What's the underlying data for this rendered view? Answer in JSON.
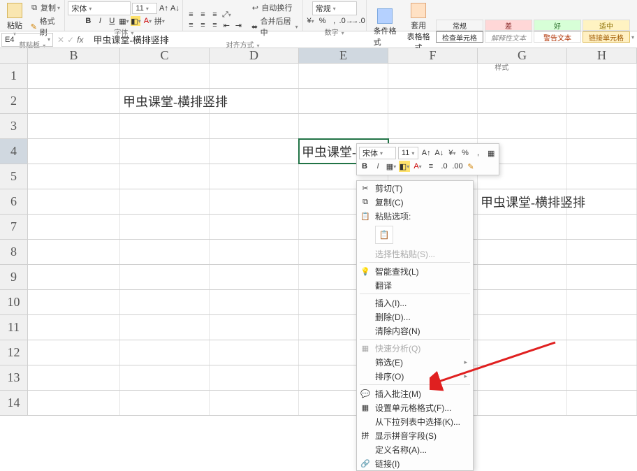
{
  "ribbon": {
    "paste": {
      "label": "粘贴",
      "copy": "复制",
      "fmt_painter": "格式刷"
    },
    "clipboard_label": "剪贴板",
    "font": {
      "name": "宋体",
      "size": "11",
      "label": "字体"
    },
    "align": {
      "wrap": "自动换行",
      "merge": "合并后居中",
      "label": "对齐方式"
    },
    "number": {
      "general": "常规",
      "label": "数字"
    },
    "cond_fmt": "条件格式",
    "as_table": "套用\n表格格式",
    "check_cell": "检查单元格",
    "styles": {
      "normal": "常规",
      "bad": "差",
      "good": "好",
      "neutral": "适中",
      "explain": "解释性文本",
      "warn": "警告文本",
      "link": "链接单元格"
    },
    "styles_label": "样式"
  },
  "formula_bar": {
    "name_box": "E4",
    "value": "甲虫课堂-横排竖排"
  },
  "columns": [
    "B",
    "C",
    "D",
    "E",
    "F",
    "G",
    "H"
  ],
  "rows": [
    "1",
    "2",
    "3",
    "4",
    "5",
    "6",
    "7",
    "8",
    "9",
    "10",
    "11",
    "12",
    "13",
    "14"
  ],
  "cells": {
    "C2": "甲虫课堂-横排竖排",
    "E4": "甲虫课堂-横排竖排",
    "G6": "甲虫课堂-横排竖排"
  },
  "mini_toolbar": {
    "font": "宋体",
    "size": "11"
  },
  "context_menu": {
    "cut": "剪切(T)",
    "copy": "复制(C)",
    "paste_opts": "粘贴选项:",
    "paste_special": "选择性粘贴(S)...",
    "smart_lookup": "智能查找(L)",
    "translate": "翻译",
    "insert": "插入(I)...",
    "delete": "删除(D)...",
    "clear": "清除内容(N)",
    "quick_analysis": "快速分析(Q)",
    "filter": "筛选(E)",
    "sort": "排序(O)",
    "insert_comment": "插入批注(M)",
    "format_cells": "设置单元格格式(F)...",
    "pick_from_list": "从下拉列表中选择(K)...",
    "show_pinyin": "显示拼音字段(S)",
    "define_name": "定义名称(A)...",
    "link": "链接(I)"
  }
}
